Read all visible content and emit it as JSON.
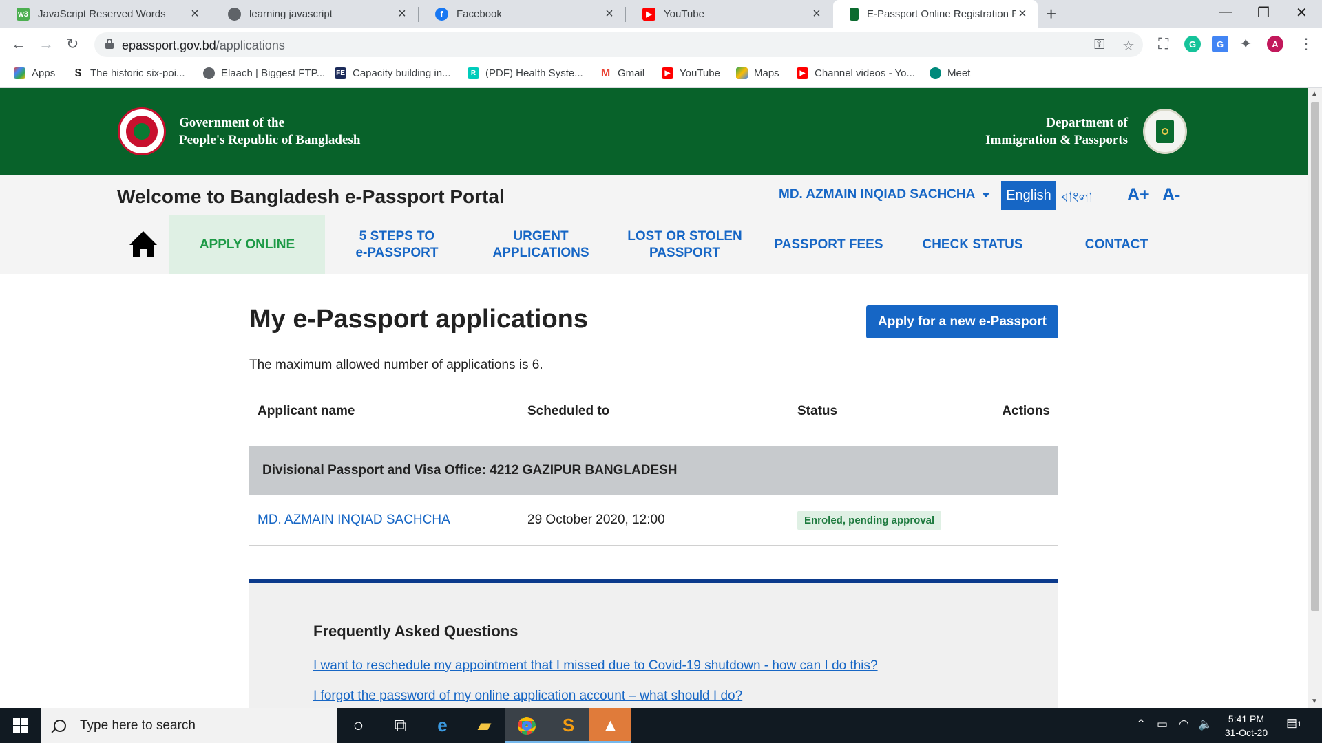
{
  "browser": {
    "tabs": [
      {
        "title": "JavaScript Reserved Words",
        "icon": "w3schools-icon"
      },
      {
        "title": "learning javascript",
        "icon": "globe-icon"
      },
      {
        "title": "Facebook",
        "icon": "facebook-icon"
      },
      {
        "title": "YouTube",
        "icon": "youtube-icon"
      },
      {
        "title": "E-Passport Online Registration Po",
        "icon": "epassport-icon",
        "active": true
      }
    ],
    "address": {
      "domain": "epassport.gov.bd",
      "path": "/applications"
    },
    "profile_initial": "A",
    "bookmarks": [
      {
        "label": "Apps",
        "icon": "apps-grid-icon"
      },
      {
        "label": "The historic six-poi...",
        "icon": "dollar-icon"
      },
      {
        "label": "Elaach | Biggest FTP...",
        "icon": "globe-icon"
      },
      {
        "label": "Capacity building in...",
        "icon": "fe-icon"
      },
      {
        "label": "(PDF) Health Syste...",
        "icon": "researchgate-icon"
      },
      {
        "label": "Gmail",
        "icon": "gmail-icon"
      },
      {
        "label": "YouTube",
        "icon": "youtube-icon"
      },
      {
        "label": "Maps",
        "icon": "maps-icon"
      },
      {
        "label": "Channel videos - Yo...",
        "icon": "youtube-icon"
      },
      {
        "label": "Meet",
        "icon": "meet-icon"
      }
    ]
  },
  "site": {
    "gov_line1": "Government of the",
    "gov_line2": "People's Republic of Bangladesh",
    "dept_line1": "Department of",
    "dept_line2": "Immigration & Passports",
    "welcome": "Welcome to Bangladesh e-Passport Portal",
    "user_name": "MD. AZMAIN INQIAD SACHCHA",
    "lang_en": "English",
    "lang_bn": "বাংলা",
    "font_increase": "A+",
    "font_decrease": "A-",
    "nav": [
      {
        "line1": "APPLY ONLINE",
        "line2": "",
        "active": true
      },
      {
        "line1": "5 STEPS TO",
        "line2": "e-PASSPORT"
      },
      {
        "line1": "URGENT",
        "line2": "APPLICATIONS"
      },
      {
        "line1": "LOST OR STOLEN",
        "line2": "PASSPORT"
      },
      {
        "line1": "PASSPORT FEES",
        "line2": ""
      },
      {
        "line1": "CHECK STATUS",
        "line2": ""
      },
      {
        "line1": "CONTACT",
        "line2": ""
      }
    ],
    "colors": {
      "banner": "#08622a",
      "link": "#1666c5",
      "active_nav": "#1d9a46"
    }
  },
  "applications": {
    "title": "My e-Passport applications",
    "apply_button": "Apply for a new e-Passport",
    "max_note": "The maximum allowed number of applications is 6.",
    "columns": [
      "Applicant name",
      "Scheduled to",
      "Status",
      "Actions"
    ],
    "office": "Divisional Passport and Visa Office: 4212 GAZIPUR BANGLADESH",
    "rows": [
      {
        "name": "MD. AZMAIN INQIAD SACHCHA",
        "scheduled": "29 October 2020, 12:00",
        "status": "Enroled, pending approval",
        "actions": ""
      }
    ]
  },
  "faq": {
    "title": "Frequently Asked Questions",
    "links": [
      "I want to reschedule my appointment that I missed due to Covid-19 shutdown - how can I do this?",
      "I forgot the password of my online application account – what should I do?"
    ]
  },
  "taskbar": {
    "search_placeholder": "Type here to search",
    "time": "5:41 PM",
    "date": "31-Oct-20",
    "notification_count": "1"
  }
}
